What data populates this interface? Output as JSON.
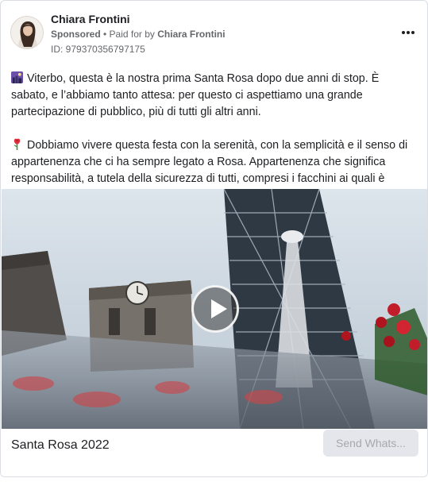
{
  "ad": {
    "author_name": "Chiara Frontini",
    "sponsored_label": "Sponsored",
    "paid_for_prefix": " • Paid for by ",
    "paid_for_name": "Chiara Frontini",
    "ad_id": "ID: 979370356797175",
    "more_icon": "more-horizontal-icon",
    "body": {
      "paragraph_1": "Viterbo, questa è la nostra prima Santa Rosa dopo due anni di stop. È sabato, e l’abbiamo tanto attesa: per questo ci aspettiamo una grande partecipazione di pubblico, più di tutti gli altri anni.",
      "paragraph_2": "Dobbiamo vivere questa festa con la serenità, con la semplicità e il senso di appartenenza che ci ha sempre legato a Rosa. Appartenenza che significa responsabilità, a tutela della sicurezza di tutti, compresi i facchini ai quali è stato…",
      "emoji_1": "night-city-emoji",
      "emoji_2": "rose-emoji"
    },
    "media": {
      "type": "video",
      "play_icon": "play-icon"
    },
    "footer": {
      "title": "Santa Rosa 2022",
      "cta_label": "Send Whats..."
    }
  },
  "colors": {
    "text": "#1c1e21",
    "secondary_text": "#65676b",
    "border": "#dadde1",
    "cta_bg": "#e4e6eb",
    "cta_text": "#a6a8ac"
  }
}
